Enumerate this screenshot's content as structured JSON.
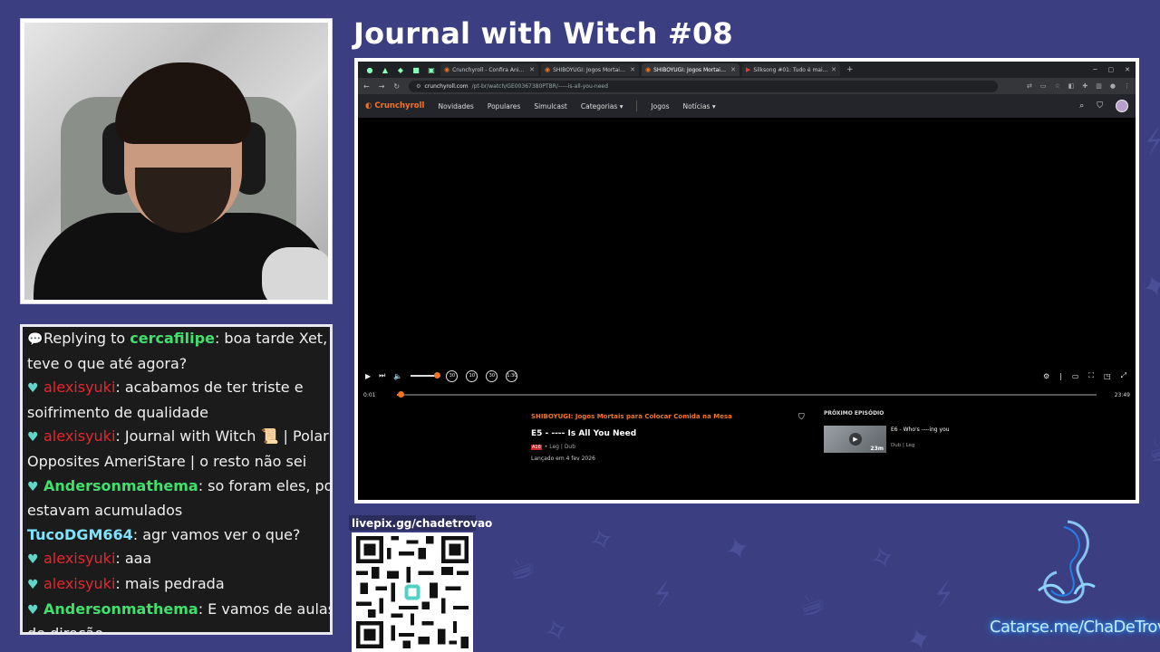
{
  "stream_title": "Journal with Witch #08",
  "chat": {
    "lines": [
      {
        "prefix": "Replying to ",
        "user": "cercafilipe",
        "text": ": boa tarde Xet, teve o que até agora?"
      },
      {
        "user": "alexisyuki",
        "text": ": acabamos de ter triste e soifrimento de qualidade"
      },
      {
        "user": "alexisyuki",
        "text": ": Journal with Witch",
        "text2": " | Polar Opposites AmeriStare | o resto não sei"
      },
      {
        "user": "Andersonmathema",
        "text": ": so foram eles, pois estavam acumulados"
      },
      {
        "user": "TucoDGM664",
        "text": ": agr vamos ver o que?"
      },
      {
        "user": "alexisyuki",
        "text": ": aaa"
      },
      {
        "user": "alexisyuki",
        "text": ": mais pedrada"
      },
      {
        "user": "Andersonmathema",
        "text": ": E vamos de aulas de direção"
      }
    ]
  },
  "browser": {
    "tabs": [
      {
        "title": "Crunchyroll - Confira Animes Em...",
        "favicon": "crunchyroll-icon",
        "active": false
      },
      {
        "title": "SHIBOYUGI: Jogos Mortais para...",
        "favicon": "crunchyroll-icon",
        "active": false
      },
      {
        "title": "SHIBOYUGI: Jogos Mortais para...",
        "favicon": "crunchyroll-icon",
        "active": true
      },
      {
        "title": "Silksong #01: Tudo é mais bom...",
        "favicon": "youtube-icon",
        "active": false
      }
    ],
    "url_domain": "crunchyroll.com",
    "url_path": "/pt-br/watch/GE00367380PTBR/-----is-all-you-need"
  },
  "crunchyroll_nav": {
    "logo": "Crunchyroll",
    "items": [
      "Novidades",
      "Populares",
      "Simulcast",
      "Categorias",
      "Jogos",
      "Notícias"
    ]
  },
  "player": {
    "current_time": "0:01",
    "duration": "23:49",
    "progress": 0.0,
    "volume": 1.0,
    "skip_labels": [
      "30",
      "10",
      "30",
      "1:30"
    ]
  },
  "episode": {
    "series": "SHIBOYUGI: Jogos Mortais para Colocar Comida na Mesa",
    "title": "E5 - ---- Is All You Need",
    "rating": "A16",
    "audio": "• Leg | Dub",
    "release": "Lançado em 4 fev 2026"
  },
  "next_episode": {
    "heading": "PRÓXIMO EPISÓDIO",
    "title": "E6 - Who's ----ing you",
    "duration": "23m",
    "meta": "Dub | Leg"
  },
  "livepix": "livepix.gg/chadetrovao",
  "catarse": "Catarse.me/ChaDeTrovao",
  "colors": {
    "background": "#3b3f82",
    "crunchyroll_orange": "#f47521",
    "chat_red_user": "#e8262c",
    "chat_green_user": "#41e06e"
  }
}
